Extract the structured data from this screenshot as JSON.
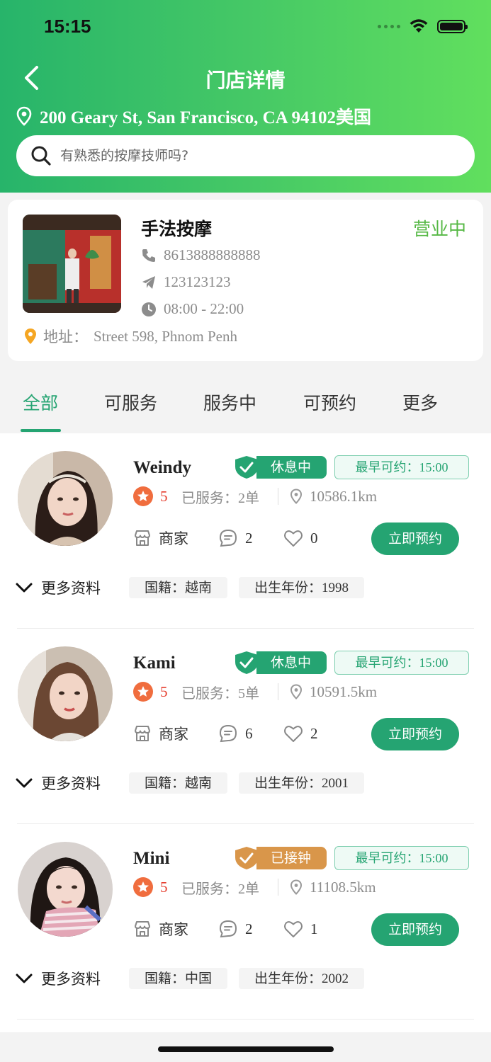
{
  "status_bar": {
    "time": "15:15"
  },
  "header": {
    "title": "门店详情",
    "address": "200 Geary St, San Francisco, CA 94102美国",
    "search_placeholder": "有熟悉的按摩技师吗?"
  },
  "store": {
    "name": "手法按摩",
    "status": "营业中",
    "phone": "8613888888888",
    "telegram": "123123123",
    "hours": "08:00 - 22:00",
    "address_label": "地址：",
    "address": "Street 598, Phnom Penh"
  },
  "tabs": [
    {
      "label": "全部"
    },
    {
      "label": "可服务"
    },
    {
      "label": "服务中"
    },
    {
      "label": "可预约"
    },
    {
      "label": "更多"
    }
  ],
  "technicians": [
    {
      "name": "Weindy",
      "status": "休息中",
      "earliest_label": "最早可约：",
      "earliest_time": "15:00",
      "rating": "5",
      "served_label": "已服务：",
      "served_count": "2单",
      "distance": "10586.1km",
      "merchant_label": "商家",
      "comments": "2",
      "likes": "0",
      "book_label": "立即预约",
      "more_label": "更多资料",
      "nationality_label": "国籍：",
      "nationality": "越南",
      "birth_label": "出生年份：",
      "birth_year": "1998"
    },
    {
      "name": "Kami",
      "status": "休息中",
      "earliest_label": "最早可约：",
      "earliest_time": "15:00",
      "rating": "5",
      "served_label": "已服务：",
      "served_count": "5单",
      "distance": "10591.5km",
      "merchant_label": "商家",
      "comments": "6",
      "likes": "2",
      "book_label": "立即预约",
      "more_label": "更多资料",
      "nationality_label": "国籍：",
      "nationality": "越南",
      "birth_label": "出生年份：",
      "birth_year": "2001"
    },
    {
      "name": "Mini",
      "status": "已接钟",
      "earliest_label": "最早可约：",
      "earliest_time": "15:00",
      "rating": "5",
      "served_label": "已服务：",
      "served_count": "2单",
      "distance": "11108.5km",
      "merchant_label": "商家",
      "comments": "2",
      "likes": "1",
      "book_label": "立即预约",
      "more_label": "更多资料",
      "nationality_label": "国籍：",
      "nationality": "中国",
      "birth_label": "出生年份：",
      "birth_year": "2002"
    }
  ],
  "colors": {
    "accent": "#25a472",
    "resting": "#25a472",
    "busy": "#d9964a",
    "open": "#56b845",
    "rating": "#e53b2b"
  }
}
